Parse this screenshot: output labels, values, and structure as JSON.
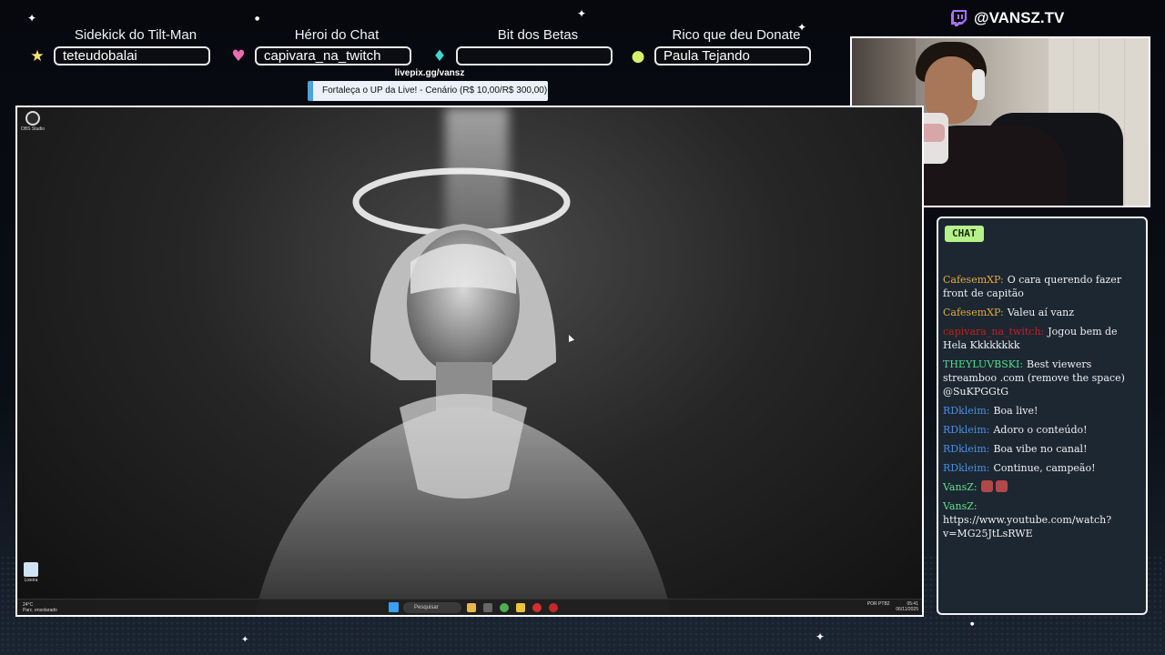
{
  "supporters": [
    {
      "title": "Sidekick do Tilt-Man",
      "name": "teteudobalai",
      "badge_icon": "star-icon",
      "badge_color": "#f5e36a"
    },
    {
      "title": "Héroi do Chat",
      "name": "capivara_na_twitch",
      "badge_icon": "heart-icon",
      "badge_color": "#f06ab0"
    },
    {
      "title": "Bit dos Betas",
      "name": "",
      "badge_icon": "diamond-icon",
      "badge_color": "#3fd6d0"
    },
    {
      "title": "Rico que deu Donate",
      "name": "Paula Tejando",
      "badge_icon": "coin-icon",
      "badge_color": "#d8f06a"
    }
  ],
  "donation": {
    "url": "livepix.gg/vansz",
    "goal_text": "Fortaleça o UP da Live! - Cenário (R$ 10,00/R$ 300,00)",
    "goal_progress": 0.033
  },
  "brand": {
    "handle": "@VANSZ.TV",
    "icon": "twitch-icon"
  },
  "chat": {
    "tag": "CHAT",
    "messages": [
      {
        "user": "CafesemXP:",
        "text": "O cara querendo fazer front de capitão",
        "color": "#e6a93a"
      },
      {
        "user": "CafesemXP:",
        "text": "Valeu aí vanz",
        "color": "#e6a93a"
      },
      {
        "user": "capivara_na_twitch:",
        "text": "Jogou bem de Hela Kkkkkkkk",
        "color": "#c81e1e"
      },
      {
        "user": "THEYLUVBSKI:",
        "text": "Best viewers streamboo .com (remove the space) @SuKPGGtG",
        "color": "#4fe08a"
      },
      {
        "user": "RDkleim:",
        "text": "Boa live!",
        "color": "#4a8fe0"
      },
      {
        "user": "RDkleim:",
        "text": "Adoro o conteúdo!",
        "color": "#4a8fe0"
      },
      {
        "user": "RDkleim:",
        "text": "Boa vibe no canal!",
        "color": "#4a8fe0"
      },
      {
        "user": "RDkleim:",
        "text": "Continue, campeão!",
        "color": "#4a8fe0"
      },
      {
        "user": "VansZ:",
        "text": "",
        "color": "#5fe08a",
        "emotes": [
          "hype-emote",
          "hype-emote"
        ]
      },
      {
        "user": "VansZ:",
        "text": "https://www.youtube.com/watch?v=MG25JtLsRWE",
        "color": "#5fe08a",
        "block": true
      }
    ]
  },
  "desktop": {
    "icons": [
      {
        "label": "OBS Studio",
        "icon": "obs-icon"
      },
      {
        "label": "Lixeira",
        "icon": "recycle-bin-icon"
      }
    ],
    "taskbar": {
      "weather_temp": "24°C",
      "weather_desc": "Parc. ensolarado",
      "search_placeholder": "Pesquisar",
      "lang": "POR PTB2",
      "time": "05:41",
      "date": "06/11/2025"
    }
  }
}
